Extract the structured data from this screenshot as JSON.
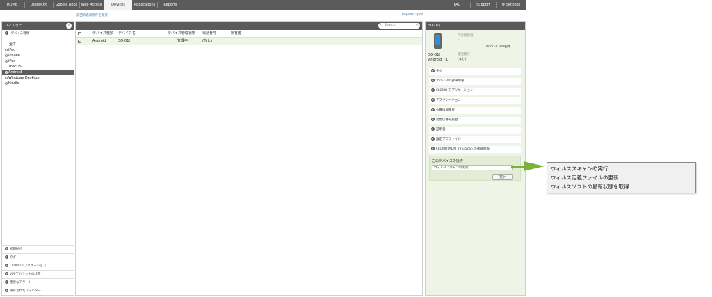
{
  "nav": {
    "tabs": [
      {
        "label": "HOME"
      },
      {
        "label": "Users/Org"
      },
      {
        "label": "Google Apps"
      },
      {
        "label": "Web Access"
      },
      {
        "label": "Devices"
      },
      {
        "label": "Applications"
      },
      {
        "label": "Reports"
      }
    ],
    "right": [
      {
        "label": "FAQ"
      },
      {
        "label": "Support"
      },
      {
        "label": "Settings"
      }
    ]
  },
  "sublinks": {
    "display_conditions": "前回の表示条件を保存",
    "import_export": "Import/Export"
  },
  "filter": {
    "header": "フィルター",
    "device_type_section": "デバイス種類",
    "device_types": [
      {
        "label": "全て",
        "dot": false,
        "selected": false
      },
      {
        "label": "iPad",
        "dot": true,
        "selected": false
      },
      {
        "label": "iPhone",
        "dot": true,
        "selected": false
      },
      {
        "label": "iPod",
        "dot": true,
        "selected": false
      },
      {
        "label": "macOS",
        "dot": false,
        "selected": false
      },
      {
        "label": "Android",
        "dot": true,
        "selected": true
      },
      {
        "label": "Windows Desktop",
        "dot": true,
        "selected": false
      },
      {
        "label": "Kindle",
        "dot": true,
        "selected": false
      }
    ],
    "bottom_sections": [
      "初期拠点",
      "タグ",
      "CLOMOアプリケーション",
      "VPPアカウントの状態",
      "重要なアラート",
      "保存されたフィルター"
    ]
  },
  "table": {
    "search_placeholder": "Search",
    "headers": {
      "device_type": "デバイス種類",
      "device_name": "デバイス名",
      "mgmt_status": "デバイス管理状態",
      "phone": "電話番号",
      "owner": "所有者"
    },
    "rows": [
      {
        "checked": true,
        "device_type": "Android",
        "device_name": "SO-01J",
        "mgmt_status": "管理中",
        "phone": "(なし)",
        "owner": ""
      }
    ]
  },
  "detail": {
    "title": "SO-01J",
    "owner_label": "所有者情報",
    "owner_value": "-",
    "edit_link": "デバイスの編集",
    "device_name": "SO-01J",
    "os": "Android 7.0",
    "phone_label": "電話番号",
    "phone_value": "(なし)",
    "sections": [
      "タグ",
      "デバイスの詳細情報",
      "CLOMO アプリケーション",
      "アプリケーション",
      "位置情報履歴",
      "発着信番号履歴",
      "証明書",
      "設定プロファイル",
      "CLOMO MDM VirusScan の詳細情報"
    ],
    "ops_title": "このデバイスの操作",
    "ops_selected": "ウィルススキャンの実行",
    "run_button": "実行"
  },
  "callout_options": [
    "ウィルススキャンの実行",
    "ウィルス定義ファイルの更新",
    "ウィルスソフトの最新状態を取得"
  ],
  "colors": {
    "nav_bg": "#5b5b5b",
    "panel_header": "#5a5a5a",
    "selected_row": "#eef6e4",
    "detail_bg": "#eef4e6",
    "link": "#2a6fb0",
    "arrow": "#7ab337"
  }
}
